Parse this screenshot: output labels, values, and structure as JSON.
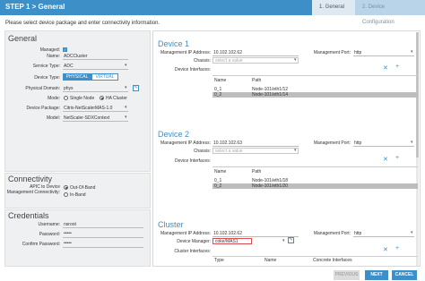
{
  "header": {
    "title": "STEP 1 > General",
    "steps": [
      "1. General",
      "2. Device Configuration"
    ]
  },
  "subtitle": "Please select device package and enter connectivity information.",
  "general": {
    "title": "General",
    "managed_label": "Managed:",
    "managed_checked": true,
    "name_label": "Name:",
    "name_value": "ADCCluster",
    "service_type_label": "Service Type:",
    "service_type_value": "ADC",
    "device_type_label": "Device Type:",
    "device_type_options": [
      "PHYSICAL",
      "VIRTUAL"
    ],
    "device_type_selected": "PHYSICAL",
    "physical_domain_label": "Physical Domain:",
    "physical_domain_value": "phys",
    "mode_label": "Mode:",
    "mode_options": [
      "Single Node",
      "HA Cluster"
    ],
    "mode_selected": "HA Cluster",
    "device_package_label": "Device Package:",
    "device_package_value": "Citrix-NetScalerMAS-1.0",
    "model_label": "Model:",
    "model_value": "NetScaler-SDXContext"
  },
  "connectivity": {
    "title": "Connectivity",
    "apic_label_line1": "APIC to Device",
    "apic_label_line2": "Management Connectivity:",
    "options": [
      "Out-Of-Band",
      "In-Band"
    ],
    "selected": "Out-Of-Band"
  },
  "credentials": {
    "title": "Credentials",
    "username_label": "Username:",
    "username_value": "nsroot",
    "password_label": "Password:",
    "password_value": "•••••",
    "confirm_label": "Confirm Password:",
    "confirm_value": "•••••"
  },
  "device1": {
    "title": "Device 1",
    "mgmt_ip_label": "Management IP Address:",
    "mgmt_ip_value": "10.102.102.62",
    "mgmt_port_label": "Management Port:",
    "mgmt_port_value": "http",
    "chassis_label": "Chassis:",
    "chassis_placeholder": "select a value",
    "interfaces_label": "Device Interfaces:",
    "columns": [
      "Name",
      "Path"
    ],
    "rows": [
      {
        "name": "0_1",
        "path": "Node-101/eth1/12"
      },
      {
        "name": "0_2",
        "path": "Node-101/eth1/14"
      }
    ]
  },
  "device2": {
    "title": "Device 2",
    "mgmt_ip_label": "Management IP Address:",
    "mgmt_ip_value": "10.102.102.63",
    "mgmt_port_label": "Management Port:",
    "mgmt_port_value": "http",
    "chassis_label": "Chassis:",
    "chassis_placeholder": "select a value",
    "interfaces_label": "Device Interfaces:",
    "columns": [
      "Name",
      "Path"
    ],
    "rows": [
      {
        "name": "0_1",
        "path": "Node-101/eth1/18"
      },
      {
        "name": "0_2",
        "path": "Node-101/eth1/20"
      }
    ]
  },
  "cluster": {
    "title": "Cluster",
    "mgmt_ip_label": "Management IP Address:",
    "mgmt_ip_value": "10.102.102.62",
    "mgmt_port_label": "Management Port:",
    "mgmt_port_value": "http",
    "device_manager_label": "Device Manager:",
    "device_manager_value": "coke/MAS1",
    "interfaces_label": "Cluster Interfaces:",
    "columns": [
      "Type",
      "Name",
      "Concrete Interfaces"
    ]
  },
  "footer": {
    "previous": "PREVIOUS",
    "next": "NEXT",
    "cancel": "CANCEL"
  }
}
